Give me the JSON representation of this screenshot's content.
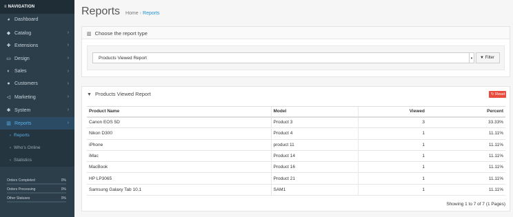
{
  "sidebar": {
    "heading": "≡ NAVIGATION",
    "items": [
      {
        "label": "Dashboard",
        "icon": "◕",
        "chev": ""
      },
      {
        "label": "Catalog",
        "icon": "◆",
        "chev": "›"
      },
      {
        "label": "Extensions",
        "icon": "✚",
        "chev": "›"
      },
      {
        "label": "Design",
        "icon": "▭",
        "chev": "›"
      },
      {
        "label": "Sales",
        "icon": "◐",
        "chev": "›"
      },
      {
        "label": "Customers",
        "icon": "●",
        "chev": "›"
      },
      {
        "label": "Marketing",
        "icon": "◁",
        "chev": "›"
      },
      {
        "label": "System",
        "icon": "✱",
        "chev": "›"
      },
      {
        "label": "Reports",
        "icon": "▥",
        "chev": "›"
      }
    ],
    "subitems": [
      {
        "label": "Reports"
      },
      {
        "label": "Who's Online"
      },
      {
        "label": "Statistics"
      }
    ],
    "stats": [
      {
        "label": "Orders Completed",
        "pct": "0%",
        "value": 0
      },
      {
        "label": "Orders Processing",
        "pct": "0%",
        "value": 0
      },
      {
        "label": "Other Statuses",
        "pct": "0%",
        "value": 0
      }
    ]
  },
  "header": {
    "title": "Reports",
    "breadcrumb_home": "Home",
    "breadcrumb_sep": "›",
    "breadcrumb_current": "Reports"
  },
  "type_panel": {
    "heading": "Choose the report type",
    "selected": "Products Viewed Report",
    "filter_label": "Filter"
  },
  "report_panel": {
    "heading": "Products Viewed Report",
    "reset_label": "Reset",
    "columns": [
      "Product Name",
      "Model",
      "Viewed",
      "Percent"
    ],
    "rows": [
      [
        "Canon EOS 5D",
        "Product 3",
        "3",
        "33.33%"
      ],
      [
        "Nikon D300",
        "Product 4",
        "1",
        "11.11%"
      ],
      [
        "iPhone",
        "product 11",
        "1",
        "11.11%"
      ],
      [
        "iMac",
        "Product 14",
        "1",
        "11.11%"
      ],
      [
        "MacBook",
        "Product 16",
        "1",
        "11.11%"
      ],
      [
        "HP LP3065",
        "Product 21",
        "1",
        "11.11%"
      ],
      [
        "Samsung Galaxy Tab 10.1",
        "SAM1",
        "1",
        "11.11%"
      ]
    ],
    "showing": "Showing 1 to 7 of 7 (1 Pages)"
  },
  "colors": {
    "sidebar_bg": "#2c3e4a",
    "accent": "#1e91cf",
    "reset": "#e84c3d"
  }
}
